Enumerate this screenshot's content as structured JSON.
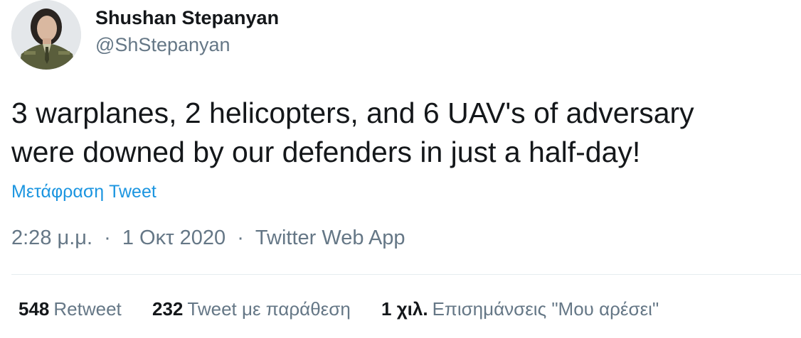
{
  "author": {
    "name": "Shushan Stepanyan",
    "handle": "@ShStepanyan"
  },
  "tweet": {
    "text_lines": [
      "3 warplanes, 2 helicopters, and 6 UAV's of adversary",
      "were downed by our defenders in just a half-day!"
    ],
    "translate_label": "Μετάφραση Tweet",
    "time": "2:28 μ.μ.",
    "date": "1 Οκτ 2020",
    "separator": "·",
    "source": "Twitter Web App"
  },
  "stats": [
    {
      "count": "548",
      "label": "Retweet"
    },
    {
      "count": "232",
      "label": "Tweet με παράθεση"
    },
    {
      "count": "1 χιλ.",
      "label": "Επισημάνσεις \"Μου αρέσει\""
    }
  ],
  "colors": {
    "text": "#14171a",
    "secondary": "#657786",
    "link": "#1b95e0",
    "divider": "#e6ecf0"
  }
}
